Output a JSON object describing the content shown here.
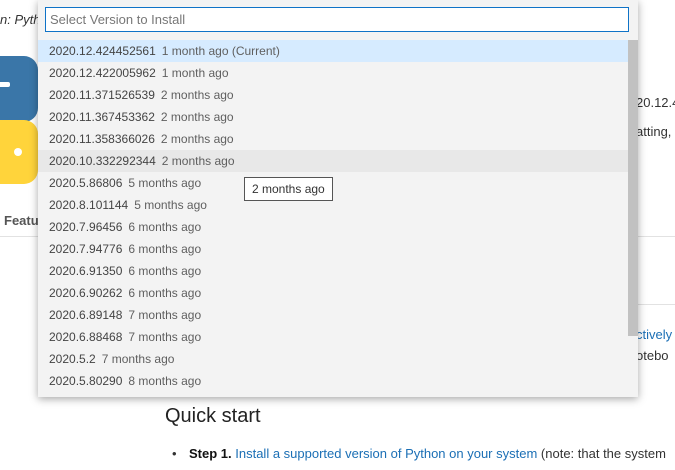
{
  "background": {
    "tab_title": "n: Pyth",
    "features_label": "Featu",
    "right_fragments": {
      "version": "20.12.4",
      "desc": "atting,",
      "link": "ctively",
      "note": "otebo"
    },
    "quick_start": "Quick start",
    "step": {
      "label": "Step 1.",
      "link": "Install a supported version of Python on your system",
      "rest": "(note: that the system"
    }
  },
  "quickpick": {
    "placeholder": "Select Version to Install",
    "value": "",
    "items": [
      {
        "version": "2020.12.424452561",
        "ago": "1 month ago (Current)"
      },
      {
        "version": "2020.12.422005962",
        "ago": "1 month ago"
      },
      {
        "version": "2020.11.371526539",
        "ago": "2 months ago"
      },
      {
        "version": "2020.11.367453362",
        "ago": "2 months ago"
      },
      {
        "version": "2020.11.358366026",
        "ago": "2 months ago"
      },
      {
        "version": "2020.10.332292344",
        "ago": "2 months ago"
      },
      {
        "version": "2020.5.86806",
        "ago": "5 months ago"
      },
      {
        "version": "2020.8.101144",
        "ago": "5 months ago"
      },
      {
        "version": "2020.7.96456",
        "ago": "6 months ago"
      },
      {
        "version": "2020.7.94776",
        "ago": "6 months ago"
      },
      {
        "version": "2020.6.91350",
        "ago": "6 months ago"
      },
      {
        "version": "2020.6.90262",
        "ago": "6 months ago"
      },
      {
        "version": "2020.6.89148",
        "ago": "7 months ago"
      },
      {
        "version": "2020.6.88468",
        "ago": "7 months ago"
      },
      {
        "version": "2020.5.2",
        "ago": "7 months ago"
      },
      {
        "version": "2020.5.80290",
        "ago": "8 months ago"
      }
    ],
    "tooltip": "2 months ago"
  },
  "colors": {
    "focus_border": "#0f73c7",
    "selected_row": "#d6ebff",
    "hover_row": "#e8e8e8",
    "link": "#1b6fb5",
    "python_blue": "#3a76a8",
    "python_yellow": "#ffd43b"
  }
}
